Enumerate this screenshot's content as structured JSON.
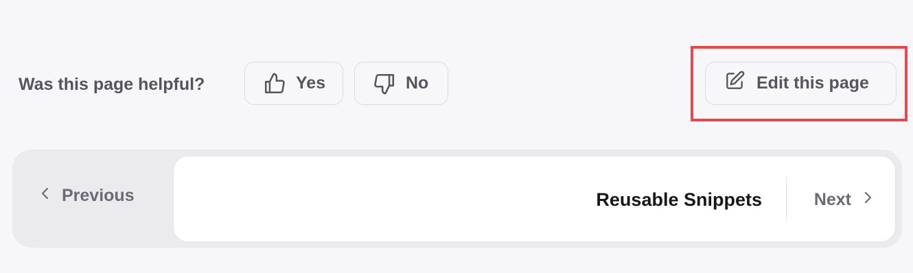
{
  "feedback": {
    "question": "Was this page helpful?",
    "yes_label": "Yes",
    "no_label": "No"
  },
  "edit": {
    "label": "Edit this page"
  },
  "pager": {
    "previous_label": "Previous",
    "next_title": "Reusable Snippets",
    "next_label": "Next"
  },
  "colors": {
    "background": "#f7f7f9",
    "highlight": "#e5484d",
    "text_muted": "#55555f",
    "text_strong": "#18181b"
  },
  "icons": [
    "thumbs-up-icon",
    "thumbs-down-icon",
    "edit-icon",
    "chevron-left-icon",
    "chevron-right-icon"
  ]
}
